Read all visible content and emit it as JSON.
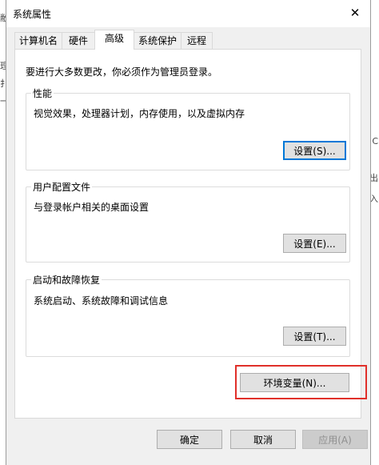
{
  "window": {
    "title": "系统属性"
  },
  "tabs": [
    {
      "label": "计算机名"
    },
    {
      "label": "硬件"
    },
    {
      "label": "高级"
    },
    {
      "label": "系统保护"
    },
    {
      "label": "远程"
    }
  ],
  "active_tab": "高级",
  "notice": "要进行大多数更改，你必须作为管理员登录。",
  "performance": {
    "title": "性能",
    "desc": "视觉效果，处理器计划，内存使用，以及虚拟内存",
    "button": "设置(S)..."
  },
  "user_profiles": {
    "title": "用户配置文件",
    "desc": "与登录帐户相关的桌面设置",
    "button": "设置(E)..."
  },
  "startup_recovery": {
    "title": "启动和故障恢复",
    "desc": "系统启动、系统故障和调试信息",
    "button": "设置(T)..."
  },
  "env_button": "环境变量(N)...",
  "footer": {
    "ok": "确定",
    "cancel": "取消",
    "apply": "应用(A)"
  },
  "background_fragments": {
    "left": [
      "敝",
      "理",
      "扌",
      "一"
    ],
    "right": [
      "C",
      "出",
      "入"
    ]
  },
  "colors": {
    "highlight": "#e0302a",
    "focus": "#0078d7",
    "window_bg": "#f0f0f0"
  }
}
